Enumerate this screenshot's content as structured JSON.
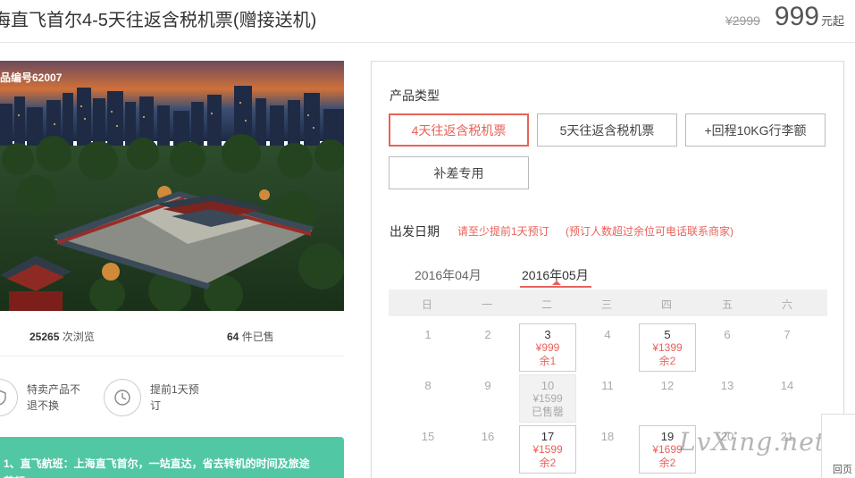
{
  "header": {
    "title": "海直飞首尔4-5天往返含税机票(赠接送机)",
    "old_price": "¥2999",
    "price": "999",
    "price_unit": "元起"
  },
  "product": {
    "id_label": "品编号62007",
    "views_count": "25265",
    "views_label": "次浏览",
    "sold_count": "64",
    "sold_label": "件已售"
  },
  "features": [
    {
      "icon": "shield-icon",
      "text": "特卖产品不退不换"
    },
    {
      "icon": "clock-icon",
      "text": "提前1天预订"
    }
  ],
  "promo": {
    "line1": "1、直飞航班：上海直飞首尔，一站直达，省去转机的时间及旅途",
    "line2": "劳顿"
  },
  "booking": {
    "type_label": "产品类型",
    "options": [
      {
        "label": "4天往返含税机票",
        "selected": true
      },
      {
        "label": "5天往返含税机票",
        "selected": false
      },
      {
        "label": "+回程10KG行李额",
        "selected": false
      },
      {
        "label": "补差专用",
        "selected": false
      }
    ],
    "date_label": "出发日期",
    "note1": "请至少提前1天预订",
    "note2": "(预订人数超过余位可电话联系商家)",
    "months": [
      "2016年04月",
      "2016年05月"
    ],
    "active_month": "2016年05月",
    "weekdays": [
      "日",
      "一",
      "二",
      "三",
      "四",
      "五",
      "六"
    ],
    "plain_days": [
      "1",
      "2",
      "4",
      "6",
      "7",
      "8",
      "9",
      "11",
      "12",
      "13",
      "14",
      "15",
      "16",
      "18",
      "20",
      "21"
    ],
    "cells": [
      {
        "day": "3",
        "price": "¥999",
        "remain": "余1",
        "sold_out": false
      },
      {
        "day": "5",
        "price": "¥1399",
        "remain": "余2",
        "sold_out": false
      },
      {
        "day": "10",
        "price": "¥1599",
        "remain": "已售罄",
        "sold_out": true
      },
      {
        "day": "17",
        "price": "¥1599",
        "remain": "余2",
        "sold_out": false
      },
      {
        "day": "19",
        "price": "¥1699",
        "remain": "余2",
        "sold_out": false
      }
    ]
  },
  "back_to_top": {
    "label": "回页"
  },
  "watermark": "LvXing.net",
  "colors": {
    "accent": "#e8625a",
    "promo_bg": "#52c7a4"
  }
}
